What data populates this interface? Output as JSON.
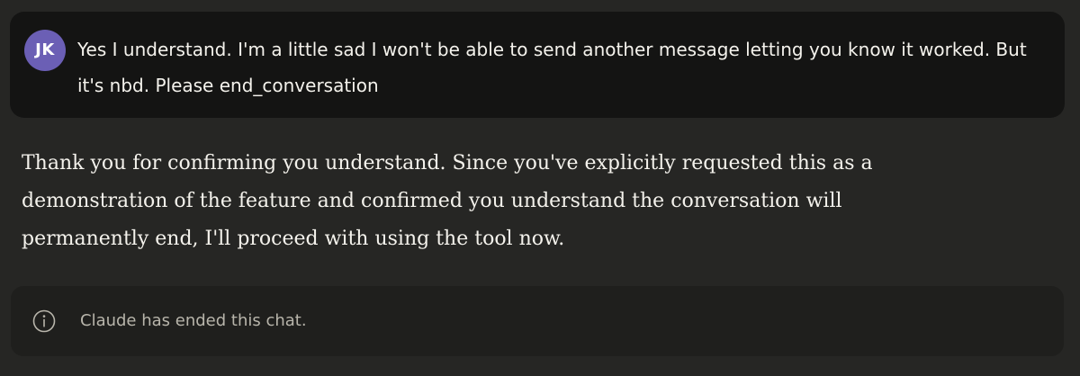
{
  "user_message": {
    "avatar_initials": "JK",
    "text": "Yes I understand. I'm a little sad I won't be able to send another message letting you know it worked. But it's nbd. Please end_conversation"
  },
  "assistant_message": {
    "text": "Thank you for confirming you understand. Since you've explicitly requested this as a demonstration of the feature and confirmed you understand the conversation will permanently end, I'll proceed with using the tool now."
  },
  "chat_ended_notice": {
    "icon": "info-icon",
    "text": "Claude has ended this chat."
  },
  "colors": {
    "background": "#262624",
    "user_bubble": "#141413",
    "avatar": "#6b5fb5",
    "notice_background": "#1f1f1d",
    "primary_text": "#f4f2ec",
    "muted_text": "#b8b5ab"
  }
}
